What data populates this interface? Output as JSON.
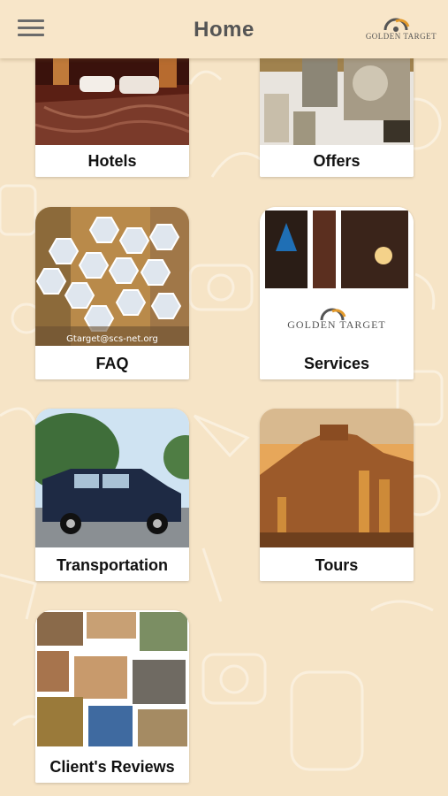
{
  "header": {
    "title": "Home",
    "menu_icon": "hamburger-menu-icon",
    "logo_text": "GOLDEN TARGET"
  },
  "colors": {
    "background": "#f6e4c6",
    "header": "#f8e6c9",
    "logo_accent": "#e39a2b"
  },
  "cards": [
    {
      "label": "Hotels"
    },
    {
      "label": "Offers"
    },
    {
      "label": "FAQ",
      "email": "Gtarget@scs-net.org"
    },
    {
      "label": "Services",
      "logo_text": "GOLDEN TARGET"
    },
    {
      "label": "Transportation"
    },
    {
      "label": "Tours"
    },
    {
      "label": "Client's Reviews"
    }
  ]
}
